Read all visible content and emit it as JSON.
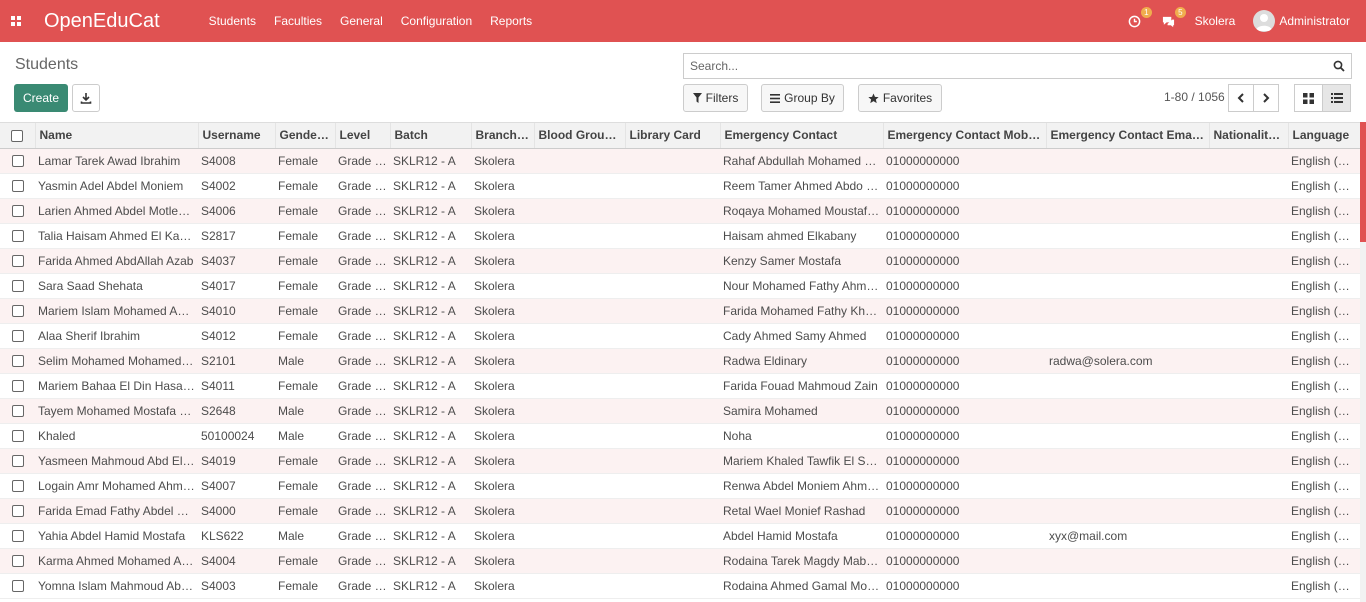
{
  "topbar": {
    "brand": "OpenEduCat",
    "menu": [
      "Students",
      "Faculties",
      "General",
      "Configuration",
      "Reports"
    ],
    "activity_badge": "1",
    "message_badge": "5",
    "company": "Skolera",
    "user": "Administrator",
    "color": "#e05252"
  },
  "control": {
    "title": "Students",
    "create_label": "Create",
    "search_placeholder": "Search...",
    "filters_label": "Filters",
    "groupby_label": "Group By",
    "favorites_label": "Favorites",
    "pager": "1-80 / 1056"
  },
  "table": {
    "columns": [
      "Name",
      "Username",
      "Gender…",
      "Level",
      "Batch",
      "Branch",
      "Blood Group…",
      "Library Card",
      "Emergency Contact",
      "Emergency Contact Mobil…",
      "Emergency Contact Emai…",
      "Nationality…",
      "Language"
    ],
    "rows": [
      [
        "Lamar Tarek Awad Ibrahim",
        "S4008",
        "Female",
        "Grade …",
        "SKLR12 - A",
        "Skolera",
        "",
        "",
        "Rahaf Abdullah Mohamed …",
        "01000000000",
        "",
        "",
        "English (US)"
      ],
      [
        "Yasmin Adel Abdel Moniem",
        "S4002",
        "Female",
        "Grade …",
        "SKLR12 - A",
        "Skolera",
        "",
        "",
        "Reem Tamer Ahmed Abdo …",
        "01000000000",
        "",
        "",
        "English (US)"
      ],
      [
        "Larien Ahmed Abdel Motleb…",
        "S4006",
        "Female",
        "Grade …",
        "SKLR12 - A",
        "Skolera",
        "",
        "",
        "Roqaya Mohamed Moustaf…",
        "01000000000",
        "",
        "",
        "English (US)"
      ],
      [
        "Talia Haisam Ahmed El Kab…",
        "S2817",
        "Female",
        "Grade …",
        "SKLR12 - A",
        "Skolera",
        "",
        "",
        "Haisam ahmed Elkabany",
        "01000000000",
        "",
        "",
        "English (US)"
      ],
      [
        "Farida Ahmed AbdAllah Azab",
        "S4037",
        "Female",
        "Grade …",
        "SKLR12 - A",
        "Skolera",
        "",
        "",
        "Kenzy Samer Mostafa",
        "01000000000",
        "",
        "",
        "English (US)"
      ],
      [
        "Sara Saad Shehata",
        "S4017",
        "Female",
        "Grade …",
        "SKLR12 - A",
        "Skolera",
        "",
        "",
        "Nour Mohamed Fathy Ahm…",
        "01000000000",
        "",
        "",
        "English (US)"
      ],
      [
        "Mariem Islam Mohamed Ah…",
        "S4010",
        "Female",
        "Grade …",
        "SKLR12 - A",
        "Skolera",
        "",
        "",
        "Farida Mohamed Fathy Kh…",
        "01000000000",
        "",
        "",
        "English (US)"
      ],
      [
        "Alaa Sherif Ibrahim",
        "S4012",
        "Female",
        "Grade …",
        "SKLR12 - A",
        "Skolera",
        "",
        "",
        "Cady Ahmed Samy Ahmed",
        "01000000000",
        "",
        "",
        "English (US)"
      ],
      [
        "Selim Mohamed Mohamed …",
        "S2101",
        "Male",
        "Grade …",
        "SKLR12 - A",
        "Skolera",
        "",
        "",
        "Radwa Eldinary",
        "01000000000",
        "radwa@solera.com",
        "",
        "English (US)"
      ],
      [
        "Mariem Bahaa El Din Hasa…",
        "S4011",
        "Female",
        "Grade …",
        "SKLR12 - A",
        "Skolera",
        "",
        "",
        "Farida Fouad Mahmoud Zain",
        "01000000000",
        "",
        "",
        "English (US)"
      ],
      [
        "Tayem Mohamed Mostafa …",
        "S2648",
        "Male",
        "Grade …",
        "SKLR12 - A",
        "Skolera",
        "",
        "",
        "Samira Mohamed",
        "01000000000",
        "",
        "",
        "English (US)"
      ],
      [
        "Khaled",
        "50100024",
        "Male",
        "Grade …",
        "SKLR12 - A",
        "Skolera",
        "",
        "",
        "Noha",
        "01000000000",
        "",
        "",
        "English (US)"
      ],
      [
        "Yasmeen Mahmoud Abd El-…",
        "S4019",
        "Female",
        "Grade …",
        "SKLR12 - A",
        "Skolera",
        "",
        "",
        "Mariem Khaled Tawfik El S…",
        "01000000000",
        "",
        "",
        "English (US)"
      ],
      [
        "Logain Amr Mohamed Ahm…",
        "S4007",
        "Female",
        "Grade …",
        "SKLR12 - A",
        "Skolera",
        "",
        "",
        "Renwa Abdel Moniem Ahm…",
        "01000000000",
        "",
        "",
        "English (US)"
      ],
      [
        "Farida Emad Fathy Abdel H…",
        "S4000",
        "Female",
        "Grade …",
        "SKLR12 - A",
        "Skolera",
        "",
        "",
        "Retal Wael Monief Rashad",
        "01000000000",
        "",
        "",
        "English (US)"
      ],
      [
        "Yahia Abdel Hamid Mostafa",
        "KLS622",
        "Male",
        "Grade …",
        "SKLR12 - A",
        "Skolera",
        "",
        "",
        "Abdel Hamid Mostafa",
        "01000000000",
        "xyx@mail.com",
        "",
        "English (US)"
      ],
      [
        "Karma Ahmed Mohamed A…",
        "S4004",
        "Female",
        "Grade …",
        "SKLR12 - A",
        "Skolera",
        "",
        "",
        "Rodaina Tarek Magdy Mabr…",
        "01000000000",
        "",
        "",
        "English (US)"
      ],
      [
        "Yomna Islam Mahmoud Ab…",
        "S4003",
        "Female",
        "Grade …",
        "SKLR12 - A",
        "Skolera",
        "",
        "",
        "Rodaina Ahmed Gamal Mo…",
        "01000000000",
        "",
        "",
        "English (US)"
      ]
    ]
  }
}
